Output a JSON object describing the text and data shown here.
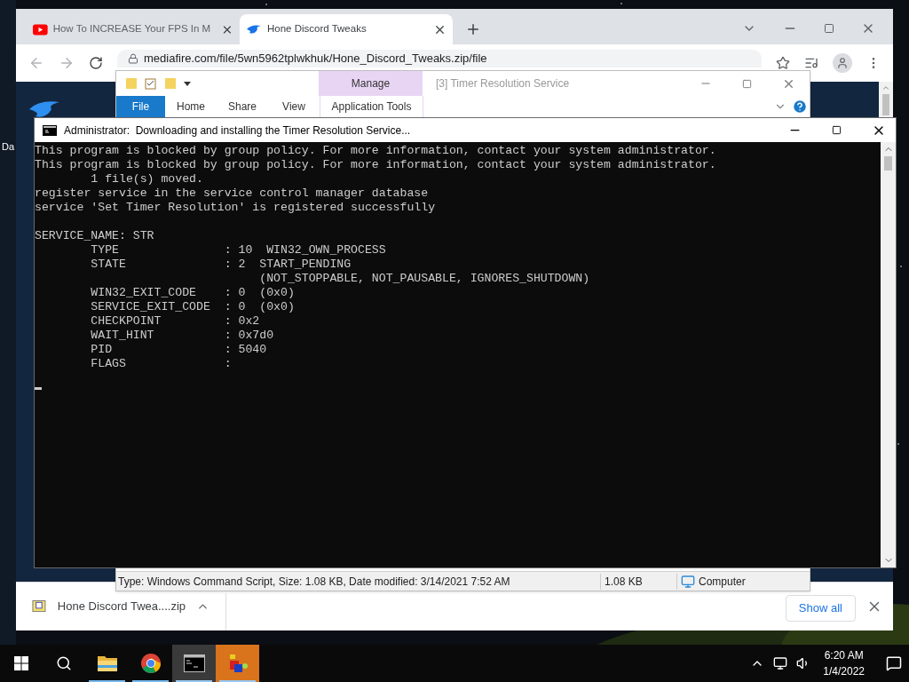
{
  "desktop": {
    "icon_label": "Da"
  },
  "browser": {
    "tabs": [
      {
        "title": "How To INCREASE Your FPS In M",
        "kind": "video",
        "selected": false
      },
      {
        "title": "Hone Discord Tweaks",
        "kind": "flame",
        "selected": true
      }
    ],
    "address": "mediafire.com/file/5wn5962tplwkhuk/Hone_Discord_Tweaks.zip/file",
    "download": {
      "filename": "Hone Discord Twea....zip"
    },
    "show_all": "Show all"
  },
  "explorer": {
    "context_tab": "Manage",
    "title": "[3] Timer Resolution Service",
    "ribbon_tabs": [
      {
        "label": "File",
        "kind": "file"
      },
      {
        "label": "Home",
        "kind": "tab"
      },
      {
        "label": "Share",
        "kind": "tab"
      },
      {
        "label": "View",
        "kind": "tab"
      },
      {
        "label": "Application Tools",
        "kind": "context"
      }
    ],
    "status": {
      "details": "Type: Windows Command Script, Size: 1.08 KB, Date modified: 3/14/2021 7:52 AM",
      "size": "1.08 KB",
      "location": "Computer"
    }
  },
  "console": {
    "title": "Administrator:  Downloading and installing the Timer Resolution Service...",
    "blocks": [
      [
        "This program is blocked by group policy. For more information, contact your system administrator.",
        "This program is blocked by group policy. For more information, contact your system administrator.",
        "        1 file(s) moved.",
        "register service in the service control manager database",
        "service 'Set Timer Resolution' is registered successfully"
      ],
      [
        "SERVICE_NAME: STR",
        "        TYPE               : 10  WIN32_OWN_PROCESS",
        "        STATE              : 2  START_PENDING",
        "                                (NOT_STOPPABLE, NOT_PAUSABLE, IGNORES_SHUTDOWN)",
        "        WIN32_EXIT_CODE    : 0  (0x0)",
        "        SERVICE_EXIT_CODE  : 0  (0x0)",
        "        CHECKPOINT         : 0x2",
        "        WAIT_HINT          : 0x7d0",
        "        PID                : 5040",
        "        FLAGS              :"
      ]
    ]
  },
  "taskbar": {
    "apps": [
      {
        "kind": "folder",
        "running": true,
        "selected": false,
        "flashing": false
      },
      {
        "kind": "browser",
        "running": true,
        "selected": false,
        "flashing": false
      },
      {
        "kind": "console",
        "running": true,
        "selected": true,
        "flashing": false
      },
      {
        "kind": "cubes",
        "running": true,
        "selected": false,
        "flashing": true
      }
    ],
    "time": "6:20 AM",
    "date": "1/4/2022"
  }
}
